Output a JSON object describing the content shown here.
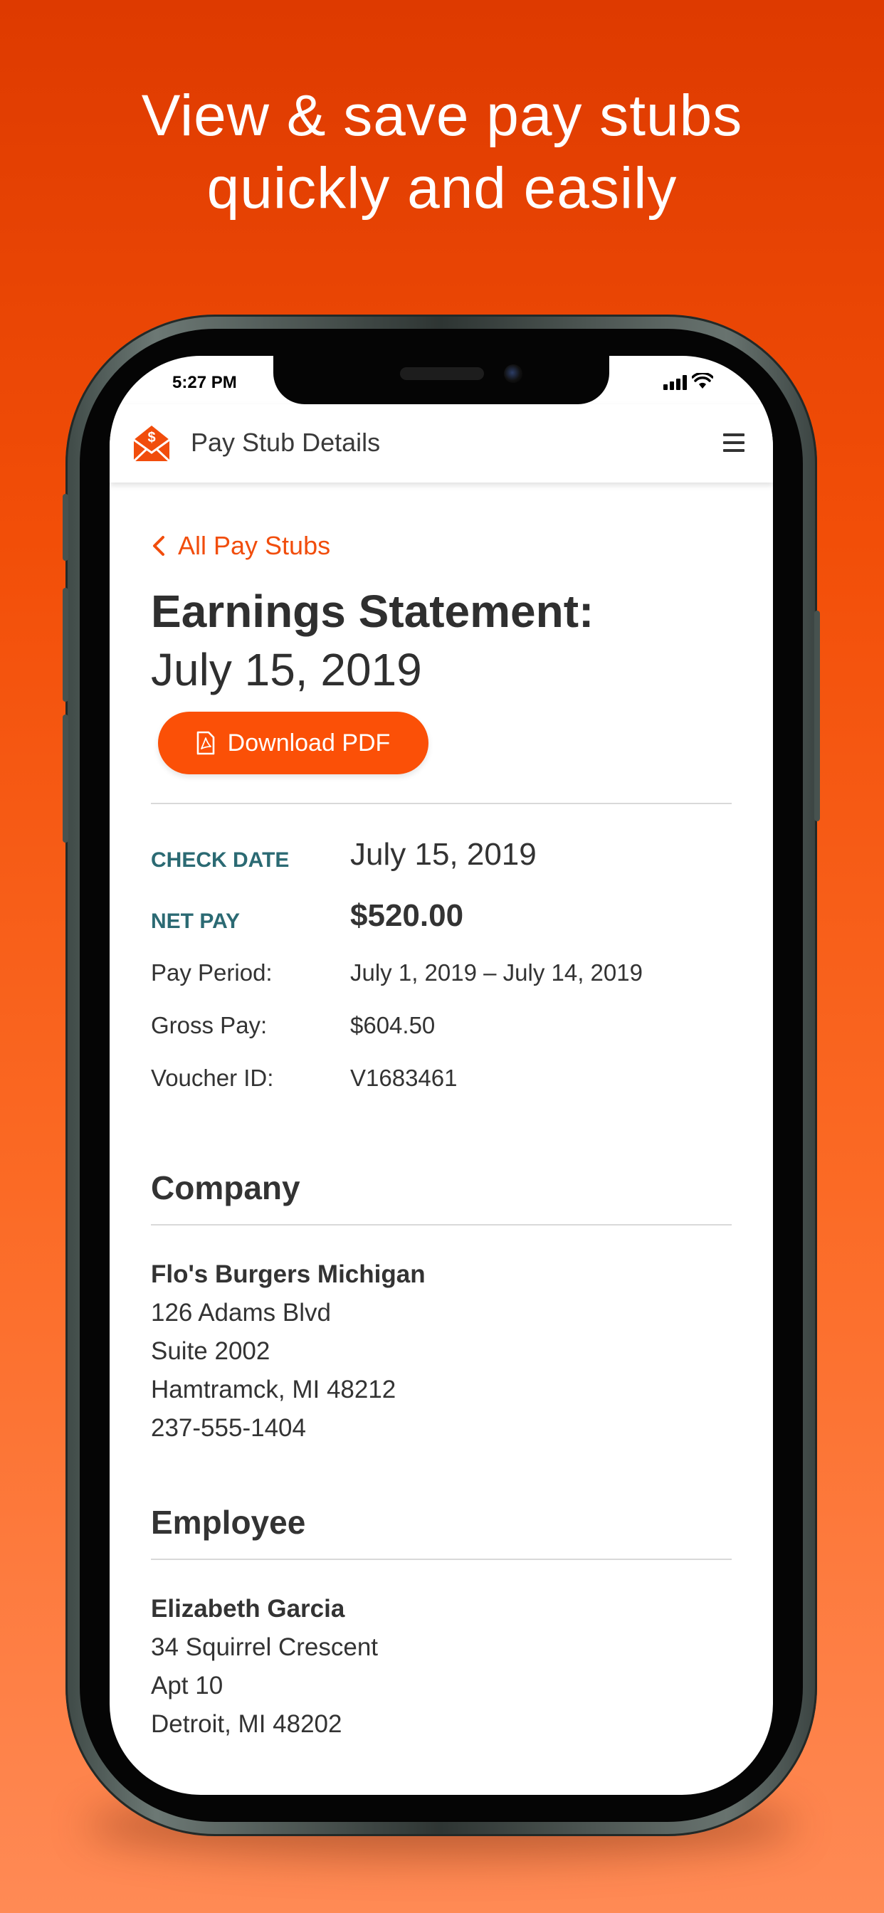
{
  "promo": {
    "headline_line1": "View & save pay stubs",
    "headline_line2": "quickly and easily"
  },
  "status_bar": {
    "time": "5:27 PM"
  },
  "header": {
    "title": "Pay Stub Details",
    "logo_icon": "envelope-dollar-icon",
    "menu_icon": "hamburger-menu-icon"
  },
  "navigation": {
    "back_label": "All Pay Stubs"
  },
  "statement": {
    "title": "Earnings Statement:",
    "date": "July 15, 2019",
    "download_label": "Download PDF"
  },
  "details": {
    "check_date": {
      "label": "CHECK DATE",
      "value": "July 15, 2019"
    },
    "net_pay": {
      "label": "NET PAY",
      "value": "$520.00"
    },
    "pay_period": {
      "label": "Pay Period:",
      "value": "July 1, 2019 – July 14, 2019"
    },
    "gross_pay": {
      "label": "Gross Pay:",
      "value": "$604.50"
    },
    "voucher_id": {
      "label": "Voucher ID:",
      "value": "V1683461"
    }
  },
  "company": {
    "heading": "Company",
    "name": "Flo's Burgers Michigan",
    "address1": "126 Adams Blvd",
    "address2": "Suite 2002",
    "city_state_zip": "Hamtramck, MI 48212",
    "phone": "237-555-1404"
  },
  "employee": {
    "heading": "Employee",
    "name": "Elizabeth Garcia",
    "address1": "34 Squirrel Crescent",
    "address2": "Apt 10",
    "city_state_zip": "Detroit, MI 48202"
  },
  "colors": {
    "accent": "#fb5007",
    "link": "#f14d0c",
    "key_label": "#2b6a73",
    "text": "#333333"
  }
}
